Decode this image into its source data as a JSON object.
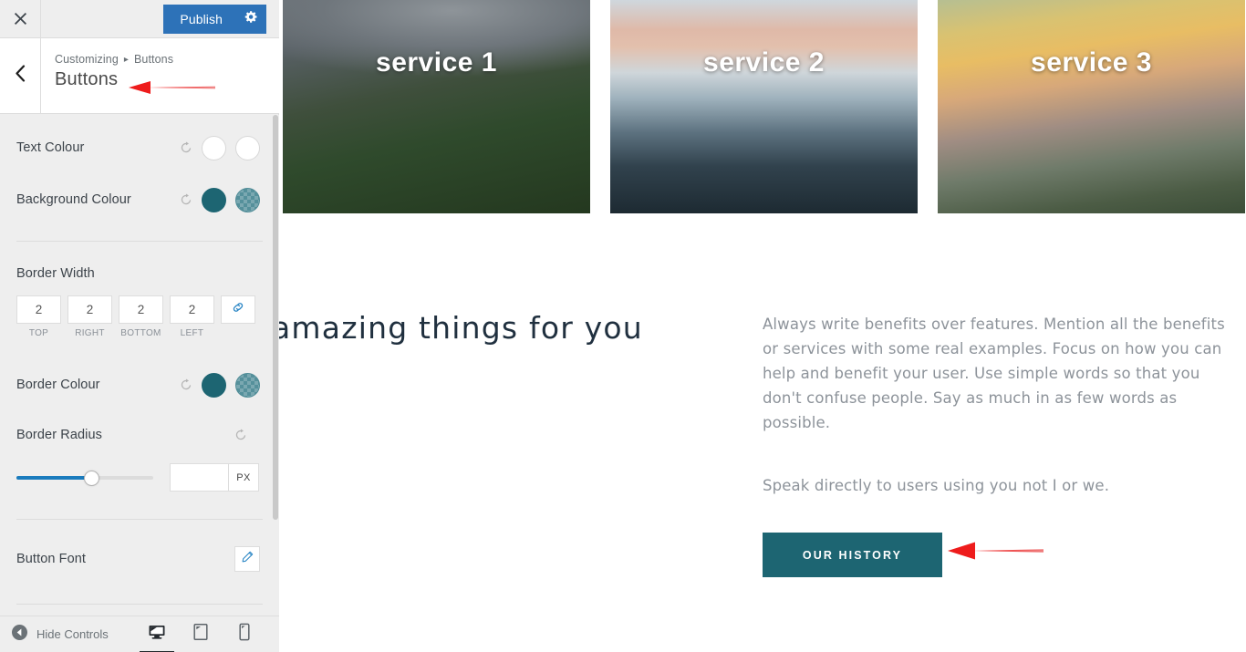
{
  "customizer": {
    "header": {
      "close_icon": "close-icon",
      "publish_label": "Publish",
      "gear_icon": "gear-icon"
    },
    "panel": {
      "back_icon": "chevron-left-icon",
      "breadcrumb_root": "Customizing",
      "breadcrumb_separator": "▸",
      "breadcrumb_current": "Buttons",
      "title": "Buttons"
    },
    "controls": [
      {
        "name": "text-colour",
        "label": "Text Colour",
        "reset_icon": "reset-icon",
        "swatches": [
          "#ffffff",
          "#ffffff"
        ]
      },
      {
        "name": "background-colour",
        "label": "Background Colour",
        "reset_icon": "reset-icon",
        "swatches": [
          "#1d6572",
          "#55909b"
        ]
      }
    ],
    "border_width": {
      "label": "Border Width",
      "inputs": [
        {
          "value": "2",
          "caption": "TOP"
        },
        {
          "value": "2",
          "caption": "RIGHT"
        },
        {
          "value": "2",
          "caption": "BOTTOM"
        },
        {
          "value": "2",
          "caption": "LEFT"
        }
      ],
      "link_icon": "link-icon"
    },
    "border_colour": {
      "label": "Border Colour",
      "reset_icon": "reset-icon",
      "swatches": [
        "#1d6572",
        "#55909b"
      ]
    },
    "border_radius": {
      "label": "Border Radius",
      "reset_icon": "reset-icon",
      "slider_percent": 55,
      "value": "",
      "unit": "PX"
    },
    "button_font": {
      "label": "Button Font",
      "edit_icon": "pencil-icon"
    },
    "footer": {
      "hide_controls_icon": "collapse-arrow-icon",
      "hide_controls_label": "Hide Controls",
      "devices": [
        {
          "name": "desktop",
          "icon": "desktop-icon",
          "active": true
        },
        {
          "name": "tablet",
          "icon": "tablet-icon",
          "active": false
        },
        {
          "name": "mobile",
          "icon": "mobile-icon",
          "active": false
        }
      ]
    }
  },
  "preview": {
    "services": [
      {
        "label": "service 1"
      },
      {
        "label": "service 2"
      },
      {
        "label": "service 3"
      }
    ],
    "headline": "amazing things for you",
    "paragraphs": [
      "Always write benefits over features. Mention all the benefits or services with some real examples. Focus on how you can help and benefit your user. Use simple words so that you don't confuse people. Say as much in as few words as possible.",
      "Speak directly to users using you not I or we."
    ],
    "cta_label": "OUR HISTORY"
  },
  "annotations": {
    "arrow_color": "#ee1c1c",
    "arrow_title_target": "Buttons",
    "arrow_cta_target": "OUR HISTORY"
  }
}
